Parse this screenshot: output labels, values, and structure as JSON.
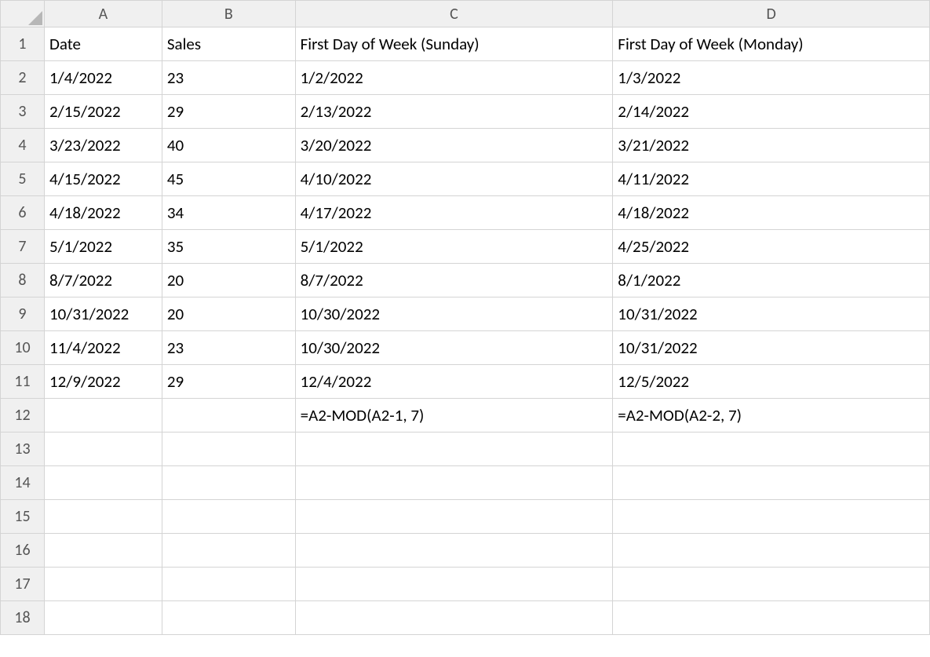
{
  "columns": [
    "A",
    "B",
    "C",
    "D"
  ],
  "rowCount": 18,
  "headers": {
    "A": "Date",
    "B": "Sales",
    "C": "First Day of Week (Sunday)",
    "D": "First Day of Week (Monday)"
  },
  "data": [
    {
      "A": "1/4/2022",
      "B": "23",
      "C": "1/2/2022",
      "D": "1/3/2022"
    },
    {
      "A": "2/15/2022",
      "B": "29",
      "C": "2/13/2022",
      "D": "2/14/2022"
    },
    {
      "A": "3/23/2022",
      "B": "40",
      "C": "3/20/2022",
      "D": "3/21/2022"
    },
    {
      "A": "4/15/2022",
      "B": "45",
      "C": "4/10/2022",
      "D": "4/11/2022"
    },
    {
      "A": "4/18/2022",
      "B": "34",
      "C": "4/17/2022",
      "D": "4/18/2022"
    },
    {
      "A": "5/1/2022",
      "B": "35",
      "C": "5/1/2022",
      "D": "4/25/2022"
    },
    {
      "A": "8/7/2022",
      "B": "20",
      "C": "8/7/2022",
      "D": "8/1/2022"
    },
    {
      "A": "10/31/2022",
      "B": "20",
      "C": "10/30/2022",
      "D": "10/31/2022"
    },
    {
      "A": "11/4/2022",
      "B": "23",
      "C": "10/30/2022",
      "D": "10/31/2022"
    },
    {
      "A": "12/9/2022",
      "B": "29",
      "C": "12/4/2022",
      "D": "12/5/2022"
    }
  ],
  "formulas": {
    "C": "=A2-MOD(A2-1, 7)",
    "D": "=A2-MOD(A2-2, 7)"
  }
}
